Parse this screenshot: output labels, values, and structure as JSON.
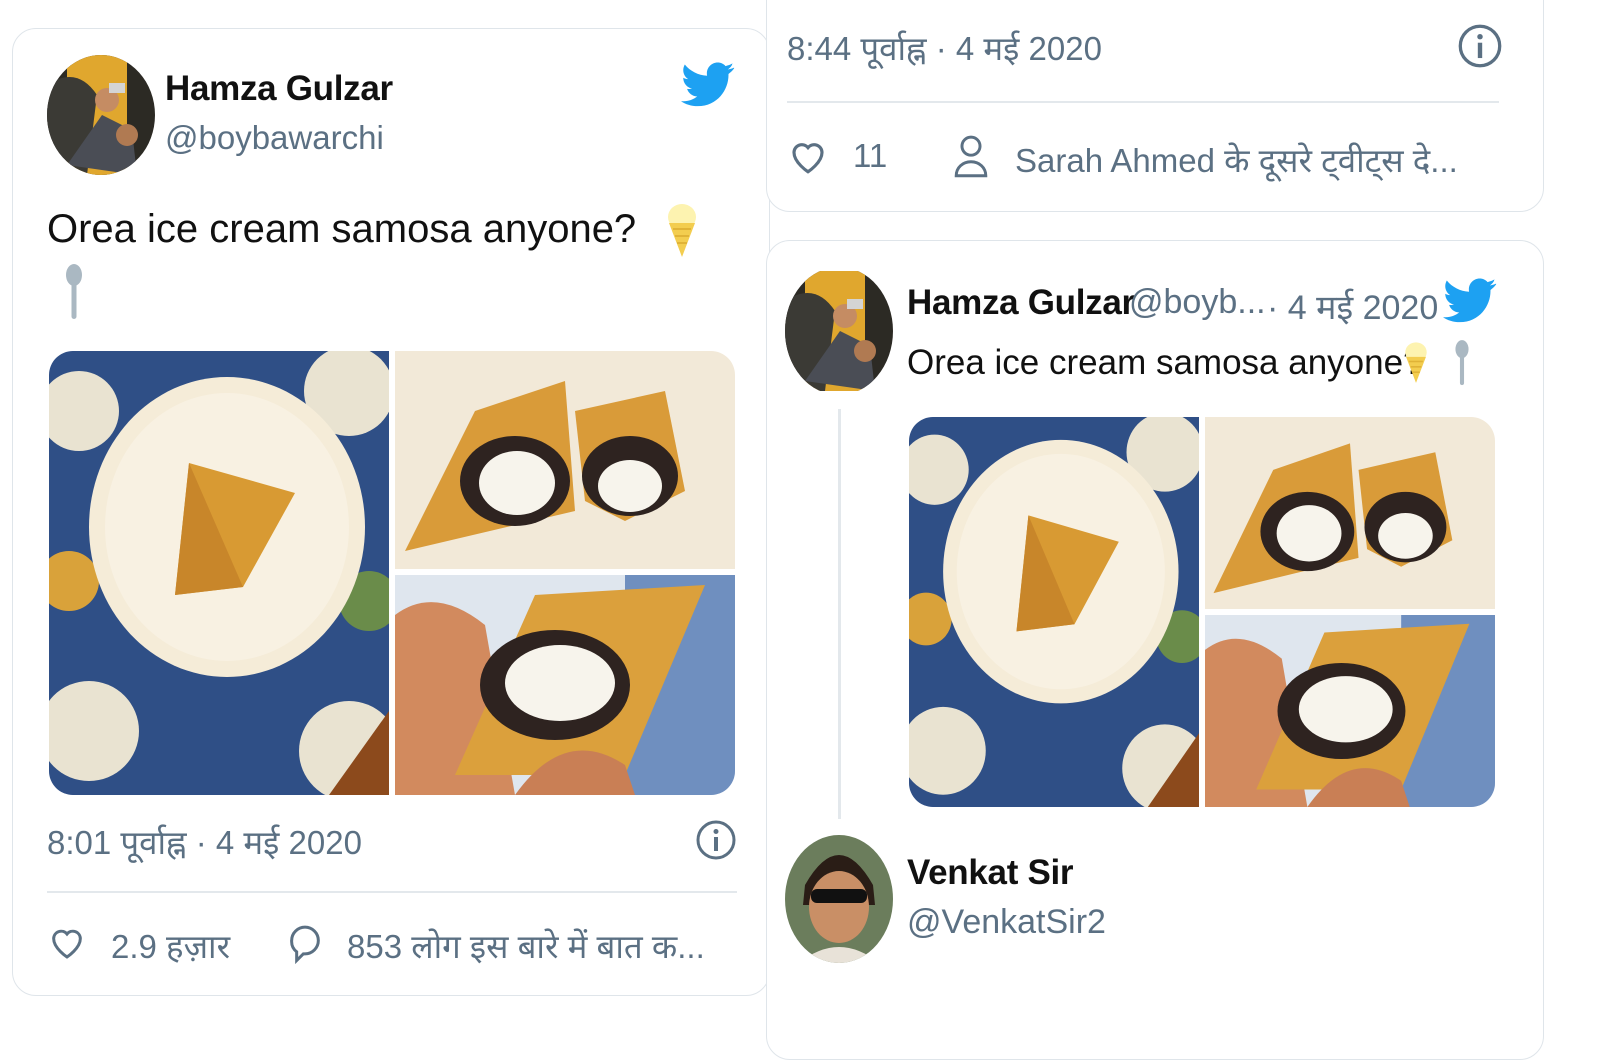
{
  "left_tweet": {
    "author_name": "Hamza Gulzar",
    "author_handle": "@boybawarchi",
    "text": "Orea ice cream samosa anyone?",
    "timestamp": "8:01 पूर्वाह्न · 4 मई 2020",
    "likes": "2.9 हज़ार",
    "replies": "853 लोग इस बारे में बात क..."
  },
  "right_top": {
    "timestamp": "8:44 पूर्वाह्न · 4 मई 2020",
    "likes": "11",
    "more_tweets": "Sarah Ahmed के दूसरे ट्वीट्स दे..."
  },
  "right_tweet": {
    "author_name": "Hamza Gulzar",
    "author_handle": "@boyb...",
    "date": "· 4 मई 2020",
    "text": "Orea ice cream samosa anyone?"
  },
  "reply_author": {
    "name": "Venkat Sir",
    "handle": "@VenkatSir2"
  },
  "colors": {
    "twitter_blue": "#1da1f2",
    "text_grey": "#5b7083",
    "border": "#dfe5ea"
  }
}
